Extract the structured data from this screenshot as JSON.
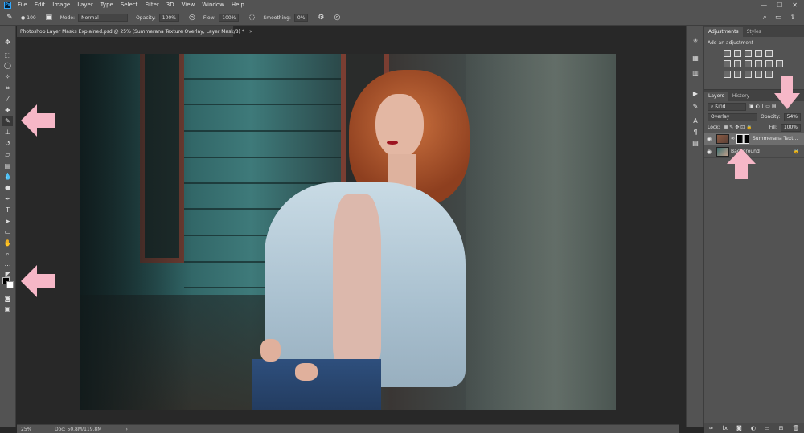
{
  "menubar": {
    "logo": "Ps",
    "items": [
      "File",
      "Edit",
      "Image",
      "Layer",
      "Type",
      "Select",
      "Filter",
      "3D",
      "View",
      "Window",
      "Help"
    ],
    "window_controls": [
      "—",
      "☐",
      "✕"
    ]
  },
  "options": {
    "brush_size": "100",
    "mode_label": "Mode:",
    "mode_value": "Normal",
    "opacity_label": "Opacity:",
    "opacity_value": "100%",
    "flow_label": "Flow:",
    "flow_value": "100%",
    "smoothing_label": "Smoothing:",
    "smoothing_value": "0%"
  },
  "document": {
    "tab_title": "Photoshop Layer Masks Explained.psd @ 25% (Summerana Texture Overlay, Layer Mask/8) *",
    "close": "×"
  },
  "status": {
    "zoom": "25%",
    "doc_info": "Doc: 50.8M/119.8M",
    "arrow": "›"
  },
  "panels": {
    "top_tabs": [
      "Adjustments",
      "Styles"
    ],
    "adjustments_title": "Add an adjustment",
    "layer_tabs": [
      "Layers",
      "History"
    ],
    "kind_label": "Kind",
    "blend_mode": "Overlay",
    "opacity_label": "Opacity:",
    "opacity_value": "54%",
    "lock_label": "Lock:",
    "fill_label": "Fill:",
    "fill_value": "100%",
    "layers": [
      {
        "name": "Summerana Text...",
        "selected": true
      },
      {
        "name": "Background",
        "selected": false
      }
    ]
  },
  "colors": {
    "ui_bg": "#535353",
    "canvas_bg": "#282828",
    "arrow_pink": "#f6b7c7"
  }
}
